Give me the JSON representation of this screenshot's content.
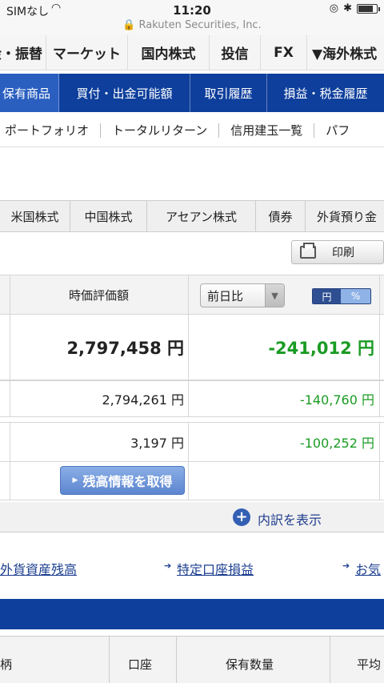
{
  "status_bar": {
    "carrier": "SIMなし",
    "time": "11:20",
    "url": "Rakuten Securities, Inc."
  },
  "main_nav": [
    "金・振替",
    "マーケット",
    "国内株式",
    "投信",
    "FX",
    "▼海外株式"
  ],
  "sub_nav": [
    "保有商品",
    "買付・出金可能額",
    "取引履歴",
    "損益・税金履歴"
  ],
  "third_nav": [
    "ポートフォリオ",
    "トータルリターン",
    "信用建玉一覧",
    "パフ"
  ],
  "market_tabs": [
    "米国株式",
    "中国株式",
    "アセアン株式",
    "債券",
    "外貨預り金"
  ],
  "print_button": "印刷",
  "table": {
    "header_label": "時価評価額",
    "compare_select": "前日比",
    "toggle_yen": "円",
    "toggle_pct": "%",
    "rows": [
      {
        "value": "2,797,458 円",
        "change": "-241,012 円"
      },
      {
        "value": "2,794,261 円",
        "change": "-140,760 円"
      },
      {
        "value": "3,197 円",
        "change": "-100,252 円"
      }
    ],
    "get_balance_button": "残高情報を取得"
  },
  "breakdown_label": "内訳を表示",
  "links": [
    "外貨資産残高",
    "特定口座損益",
    "お気"
  ],
  "bottom_headers": [
    "柄",
    "口座",
    "保有数量",
    "平均"
  ]
}
